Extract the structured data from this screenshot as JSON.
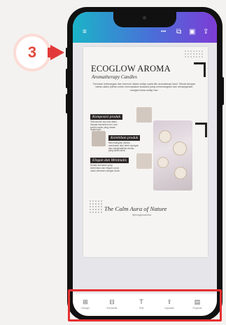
{
  "step": {
    "number": "3"
  },
  "status_icons": {
    "more": "•••",
    "resize": "⧉",
    "layers": "▣",
    "share": "⇪"
  },
  "design": {
    "brand": "ECOGLOW AROMA",
    "tagline": "Aromatherapy Candles",
    "intro": "Temukan ketenangan dan harmoni dalam setiap nyala lilin aromaterapi kami. Dibuat dengan bahan alami pilihan untuk menciptakan suasana yang menenangkan dan menyegarkan ruangan Anda setiap hari.",
    "features": [
      {
        "label": "Komposisi produk",
        "body": "Terbuat dari soy wax alami, minyak esensial murni, dan sumbu katun yang ramah lingkungan."
      },
      {
        "label": "Kelebihan produk",
        "body": "Menenangkan pikiran, membantu tidur lebih nyenyak, dan menghadirkan aroma yang tahan lama."
      },
      {
        "label": "Elegan dan Minimalis",
        "body": "Desain kemasan yang sederhana dan elegan cocok untuk dekorasi ruangan Anda."
      }
    ],
    "footer_title": "The Calm Aura of Nature",
    "footer_handle": "@ecoglowaroma"
  },
  "toolbar": {
    "items": [
      {
        "icon": "⊞",
        "label": "Design"
      },
      {
        "icon": "⊟",
        "label": "Elements"
      },
      {
        "icon": "T",
        "label": "Text"
      },
      {
        "icon": "⇪",
        "label": "Uploads"
      },
      {
        "icon": "▤",
        "label": "Projects"
      }
    ]
  }
}
